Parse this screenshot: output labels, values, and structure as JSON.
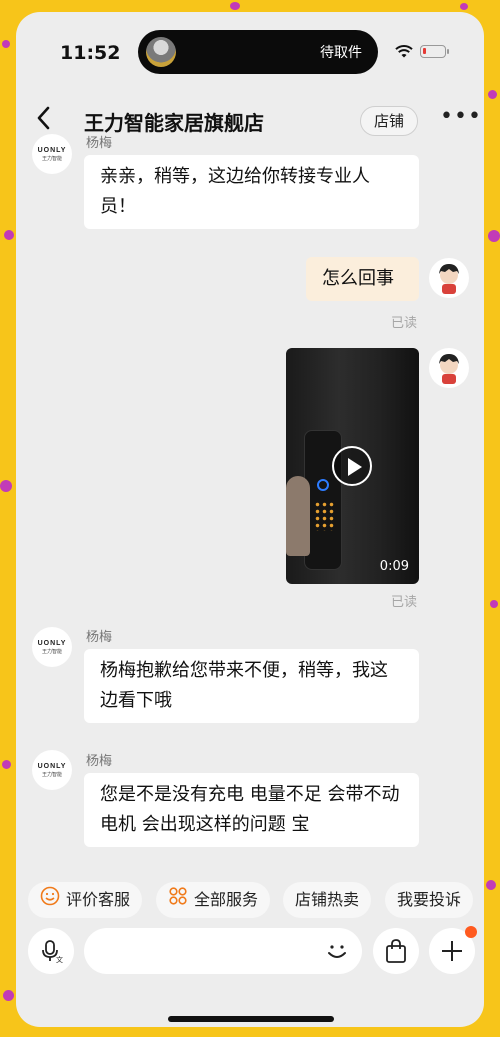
{
  "status_bar": {
    "time": "11:52",
    "island_text": "待取件",
    "battery_level": 0.15,
    "battery_color": "#e53935"
  },
  "header": {
    "back_icon": "chevron-left-icon",
    "title": "王力智能家居旗舰店",
    "shop_button": "店铺",
    "more_icon": "more-dots-icon"
  },
  "messages": [
    {
      "side": "left",
      "sender": "杨梅",
      "avatar_logo": "UONLY",
      "avatar_logo_sub": "王力智能",
      "text": "亲亲，稍等，这边给你转接专业人员！"
    },
    {
      "side": "right",
      "text": "怎么回事",
      "status": "已读"
    },
    {
      "side": "right",
      "type": "video",
      "duration": "0:09",
      "status": "已读"
    },
    {
      "side": "left",
      "sender": "杨梅",
      "avatar_logo": "UONLY",
      "avatar_logo_sub": "王力智能",
      "text": "杨梅抱歉给您带来不便，稍等，我这边看下哦"
    },
    {
      "side": "left",
      "sender": "杨梅",
      "avatar_logo": "UONLY",
      "avatar_logo_sub": "王力智能",
      "text": "您是不是没有充电 电量不足 会带不动电机 会出现这样的问题 宝"
    }
  ],
  "quick_actions": [
    {
      "label": "评价客服",
      "icon": "smile-icon"
    },
    {
      "label": "全部服务",
      "icon": "grid-icon"
    },
    {
      "label": "店铺热卖",
      "icon": ""
    },
    {
      "label": "我要投诉",
      "icon": ""
    }
  ],
  "input_bar": {
    "mic_icon": "voice-icon",
    "emoji_icon": "emoji-icon",
    "bag_icon": "shopping-bag-icon",
    "plus_icon": "plus-icon",
    "accent": "#ff5a1f"
  }
}
